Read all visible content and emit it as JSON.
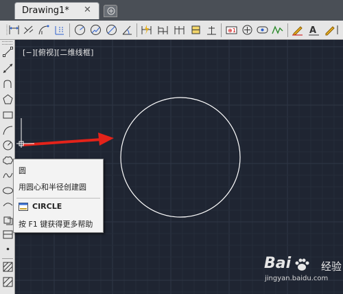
{
  "tabs": {
    "active_title": "Drawing1*",
    "close_glyph": "✕"
  },
  "ribbon": {
    "tools": [
      "dim-linear-icon",
      "dim-aligned-icon",
      "dim-arc-icon",
      "dim-ordinate-icon",
      "dim-radius-icon",
      "dim-jogged-icon",
      "dim-diameter-icon",
      "dim-angular-icon",
      "quick-dim-icon",
      "dim-baseline-icon",
      "dim-continue-icon",
      "dim-space-icon",
      "dim-break-icon",
      "tolerance-icon",
      "center-mark-icon",
      "inspect-icon",
      "jogged-linear-icon",
      "dim-edit-icon",
      "dim-text-edit-icon",
      "dim-update-icon"
    ]
  },
  "left_toolbar": {
    "tools": [
      "line-icon",
      "construction-line-icon",
      "polyline-icon",
      "polygon-icon",
      "rectangle-icon",
      "arc-icon",
      "circle-icon",
      "revision-cloud-icon",
      "spline-icon",
      "ellipse-icon",
      "ellipse-arc-icon",
      "insert-block-icon",
      "make-block-icon",
      "point-icon",
      "hatch-icon",
      "gradient-icon",
      "region-icon"
    ]
  },
  "viewport": {
    "label": "[−][俯视][二维线框]",
    "background": "#1f2532",
    "grid_minor": "#262d3a",
    "grid_major": "#2f3746"
  },
  "tooltip": {
    "title": "圆",
    "description": "用圆心和半径创建圆",
    "command": "CIRCLE",
    "help": "按 F1 键获得更多帮助"
  },
  "annotation": {
    "arrow_color": "#e3231a"
  },
  "watermark": {
    "brand": "Bai",
    "brand_suffix": "经验",
    "url": "jingyan.baidu.com"
  }
}
